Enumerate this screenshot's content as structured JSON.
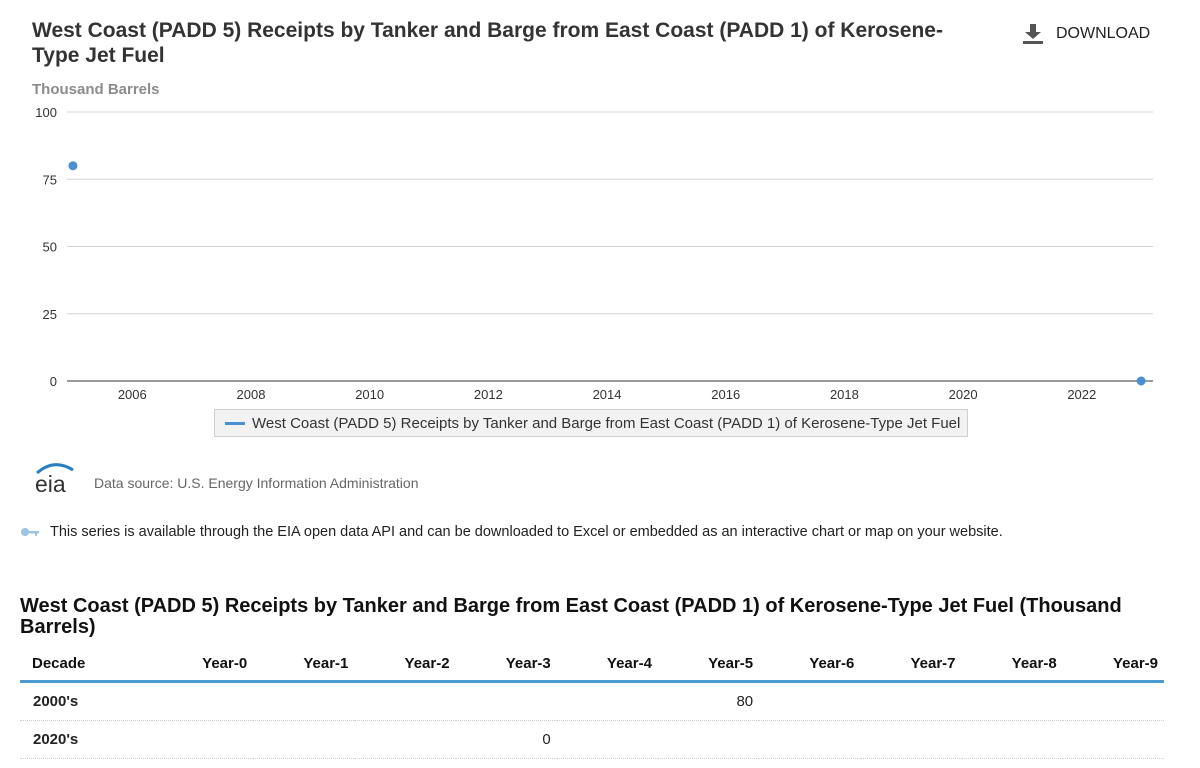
{
  "header": {
    "title": "West Coast (PADD 5) Receipts by Tanker and Barge from East Coast (PADD 1) of Kerosene-Type Jet Fuel",
    "download_label": "DOWNLOAD",
    "download_icon": "download-icon"
  },
  "chart_data": {
    "type": "line",
    "title": "West Coast (PADD 5) Receipts by Tanker and Barge from East Coast (PADD 1) of Kerosene-Type Jet Fuel",
    "ylabel": "Thousand Barrels",
    "xlabel": "",
    "ylim": [
      0,
      100
    ],
    "xlim": [
      2004.9,
      2023.2
    ],
    "y_ticks": [
      0,
      25,
      50,
      75,
      100
    ],
    "x_ticks": [
      2006,
      2008,
      2010,
      2012,
      2014,
      2016,
      2018,
      2020,
      2022
    ],
    "grid": true,
    "legend_position": "bottom-center",
    "series": [
      {
        "name": "West Coast (PADD 5) Receipts by Tanker and Barge from East Coast (PADD 1) of Kerosene-Type Jet Fuel",
        "color": "#4a8fd1",
        "points": [
          {
            "x": 2005,
            "y": 80
          },
          {
            "x": 2023,
            "y": 0
          }
        ]
      }
    ]
  },
  "source": {
    "logo_text": "eia",
    "text": "Data source: U.S. Energy Information Administration"
  },
  "api_note": {
    "text": "This series is available through the EIA open data API and can be downloaded to Excel or embedded as an interactive chart or map on your website.",
    "icon": "key-icon"
  },
  "table": {
    "title": "West Coast (PADD 5) Receipts by Tanker and Barge from East Coast (PADD 1) of Kerosene-Type Jet Fuel (Thousand Barrels)",
    "headers": [
      "Decade",
      "Year-0",
      "Year-1",
      "Year-2",
      "Year-3",
      "Year-4",
      "Year-5",
      "Year-6",
      "Year-7",
      "Year-8",
      "Year-9"
    ],
    "rows": [
      {
        "decade": "2000's",
        "values": [
          "",
          "",
          "",
          "",
          "",
          "80",
          "",
          "",
          "",
          ""
        ]
      },
      {
        "decade": "2020's",
        "values": [
          "",
          "",
          "",
          "0",
          "",
          "",
          "",
          "",
          "",
          ""
        ]
      }
    ]
  }
}
